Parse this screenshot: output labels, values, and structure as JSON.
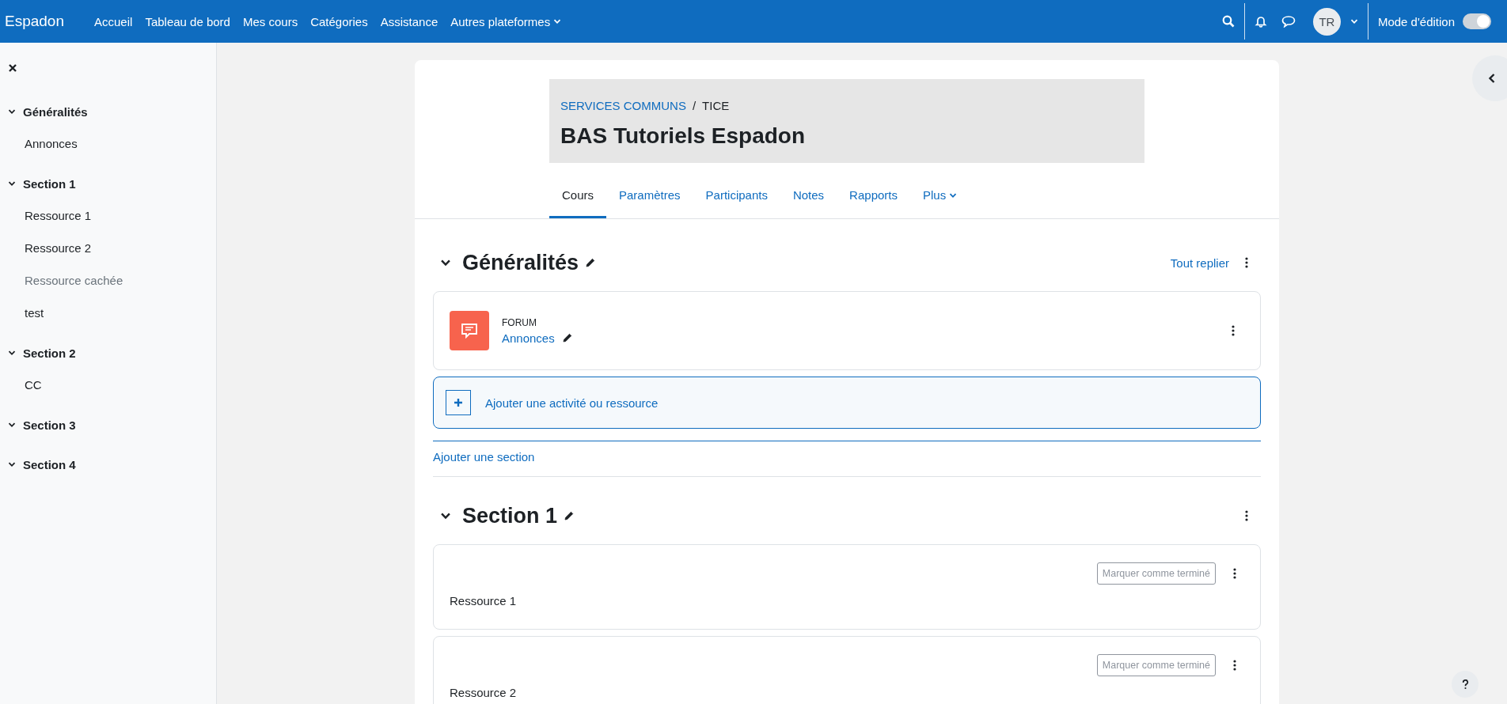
{
  "topbar": {
    "brand": "Espadon",
    "nav": [
      {
        "label": "Accueil",
        "dropdown": false
      },
      {
        "label": "Tableau de bord",
        "dropdown": false
      },
      {
        "label": "Mes cours",
        "dropdown": false
      },
      {
        "label": "Catégories",
        "dropdown": false
      },
      {
        "label": "Assistance",
        "dropdown": false
      },
      {
        "label": "Autres plateformes",
        "dropdown": true
      }
    ],
    "avatar": "TR",
    "edit_mode": {
      "label": "Mode d'édition",
      "on": true
    }
  },
  "sidebar": {
    "sections": [
      {
        "title": "Généralités",
        "expanded": true,
        "children": [
          {
            "label": "Annonces",
            "hidden": false
          }
        ]
      },
      {
        "title": "Section 1",
        "expanded": true,
        "children": [
          {
            "label": "Ressource 1",
            "hidden": false
          },
          {
            "label": "Ressource 2",
            "hidden": false
          },
          {
            "label": "Ressource cachée",
            "hidden": true
          },
          {
            "label": "test",
            "hidden": false
          }
        ]
      },
      {
        "title": "Section 2",
        "expanded": true,
        "children": [
          {
            "label": "CC",
            "hidden": false
          }
        ]
      },
      {
        "title": "Section 3",
        "expanded": true
      },
      {
        "title": "Section 4",
        "expanded": true
      }
    ]
  },
  "course": {
    "breadcrumb": [
      {
        "label": "SERVICES COMMUNS",
        "link": true
      },
      {
        "label": "TICE",
        "link": false
      }
    ],
    "separator": "/",
    "title": "BAS Tutoriels Espadon",
    "tabs": [
      {
        "label": "Cours",
        "selected": true,
        "dropdown": false
      },
      {
        "label": "Paramètres",
        "selected": false,
        "dropdown": false
      },
      {
        "label": "Participants",
        "selected": false,
        "dropdown": false
      },
      {
        "label": "Notes",
        "selected": false,
        "dropdown": false
      },
      {
        "label": "Rapports",
        "selected": false,
        "dropdown": false
      },
      {
        "label": "Plus",
        "selected": false,
        "dropdown": true
      }
    ],
    "collapse_all": "Tout replier",
    "sections": [
      {
        "title": "Généralités",
        "expanded": true,
        "activities": [
          {
            "kind": "forum",
            "type_label": "FORUM",
            "name": "Annonces"
          }
        ],
        "add_activity": "Ajouter une activité ou ressource",
        "add_section": "Ajouter une section"
      },
      {
        "title": "Section 1",
        "expanded": true,
        "activities": [
          {
            "kind": "text",
            "name": "Ressource 1",
            "completion": "Marquer comme terminé"
          },
          {
            "kind": "text",
            "name": "Ressource 2",
            "completion": "Marquer comme terminé"
          }
        ]
      }
    ]
  }
}
